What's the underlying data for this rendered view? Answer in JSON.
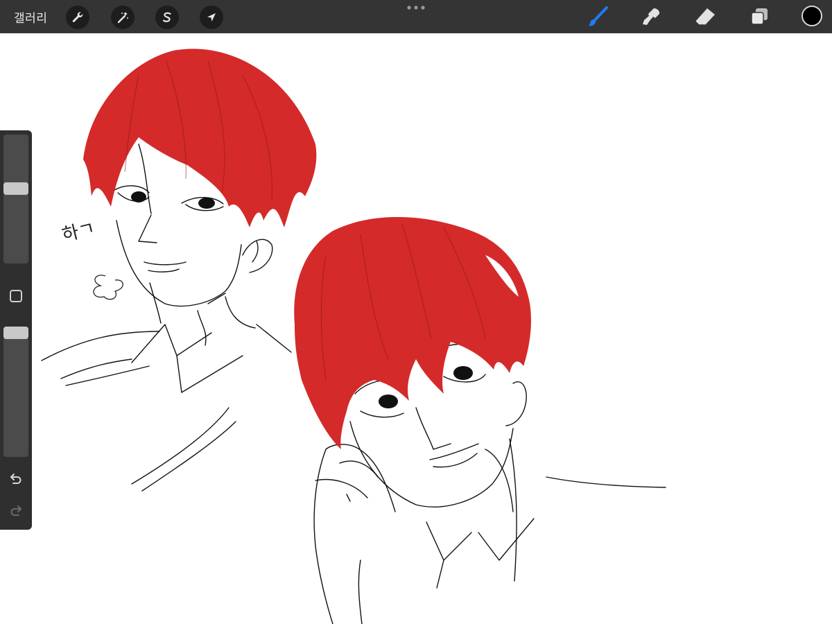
{
  "toolbar": {
    "gallery_label": "갤러리",
    "left_tools": [
      {
        "name": "actions",
        "icon": "wrench-icon"
      },
      {
        "name": "adjustments",
        "icon": "magic-wand-icon"
      },
      {
        "name": "selection",
        "icon": "selection-s-icon"
      },
      {
        "name": "transform",
        "icon": "arrow-cursor-icon"
      }
    ],
    "more_icon": "more-dots-icon",
    "right_tools": [
      {
        "name": "brush",
        "icon": "brush-icon",
        "active": true
      },
      {
        "name": "smudge",
        "icon": "smudge-icon",
        "active": false
      },
      {
        "name": "eraser",
        "icon": "eraser-icon",
        "active": false
      },
      {
        "name": "layers",
        "icon": "layers-icon",
        "active": false
      }
    ],
    "current_color": "#000000",
    "active_tool_color": "#1e7cf2"
  },
  "sidebar": {
    "brush_size_level": 0.59,
    "brush_opacity_level": 1.0,
    "modifier_icon": "square-modifier-icon",
    "undo_icon": "undo-icon",
    "redo_icon": "redo-icon"
  },
  "canvas": {
    "handwritten_text": "하ㄱ",
    "hair_color": "#d42a2a",
    "line_color": "#111111"
  }
}
